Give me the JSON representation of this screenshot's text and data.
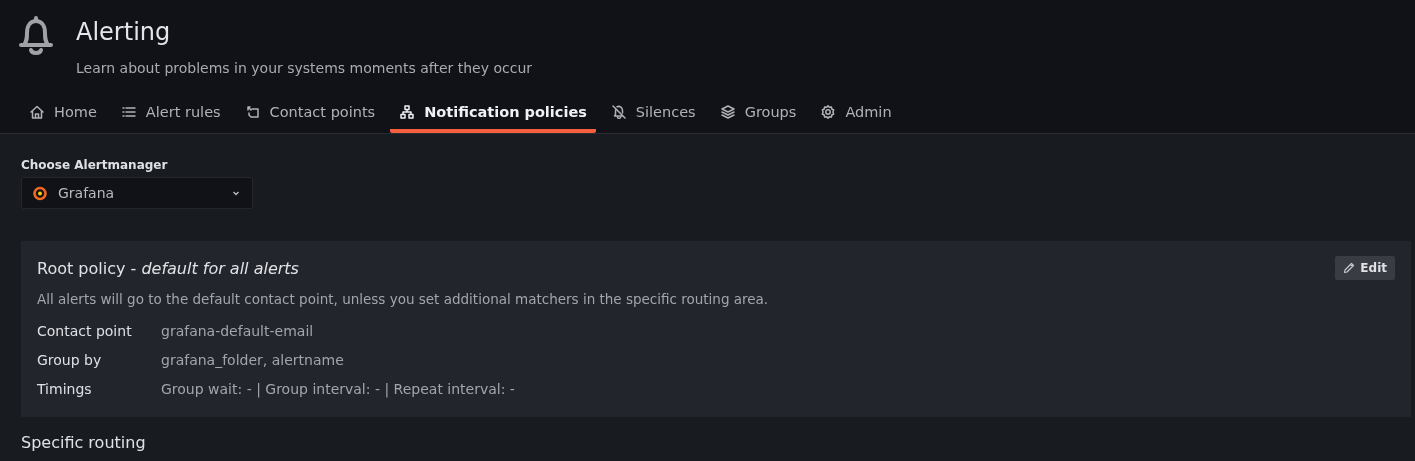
{
  "header": {
    "title": "Alerting",
    "subtitle": "Learn about problems in your systems moments after they occur"
  },
  "tabs": [
    {
      "label": "Home",
      "selected": false
    },
    {
      "label": "Alert rules",
      "selected": false
    },
    {
      "label": "Contact points",
      "selected": false
    },
    {
      "label": "Notification policies",
      "selected": true
    },
    {
      "label": "Silences",
      "selected": false
    },
    {
      "label": "Groups",
      "selected": false
    },
    {
      "label": "Admin",
      "selected": false
    }
  ],
  "alertmanager": {
    "label": "Choose Alertmanager",
    "value": "Grafana"
  },
  "root_policy": {
    "title": "Root policy - *default for all alerts*",
    "edit_button": "Edit",
    "description": "All alerts will go to the default contact point, unless you set additional matchers in the specific routing area.",
    "details": [
      {
        "label": "Contact point",
        "value": "grafana-default-email"
      },
      {
        "label": "Group by",
        "value": "grafana_folder, alertname"
      },
      {
        "label": "Timings",
        "value": "Group wait: - | Group interval: - | Repeat interval: -"
      }
    ]
  },
  "specific_routing": {
    "title": "Specific routing"
  }
}
